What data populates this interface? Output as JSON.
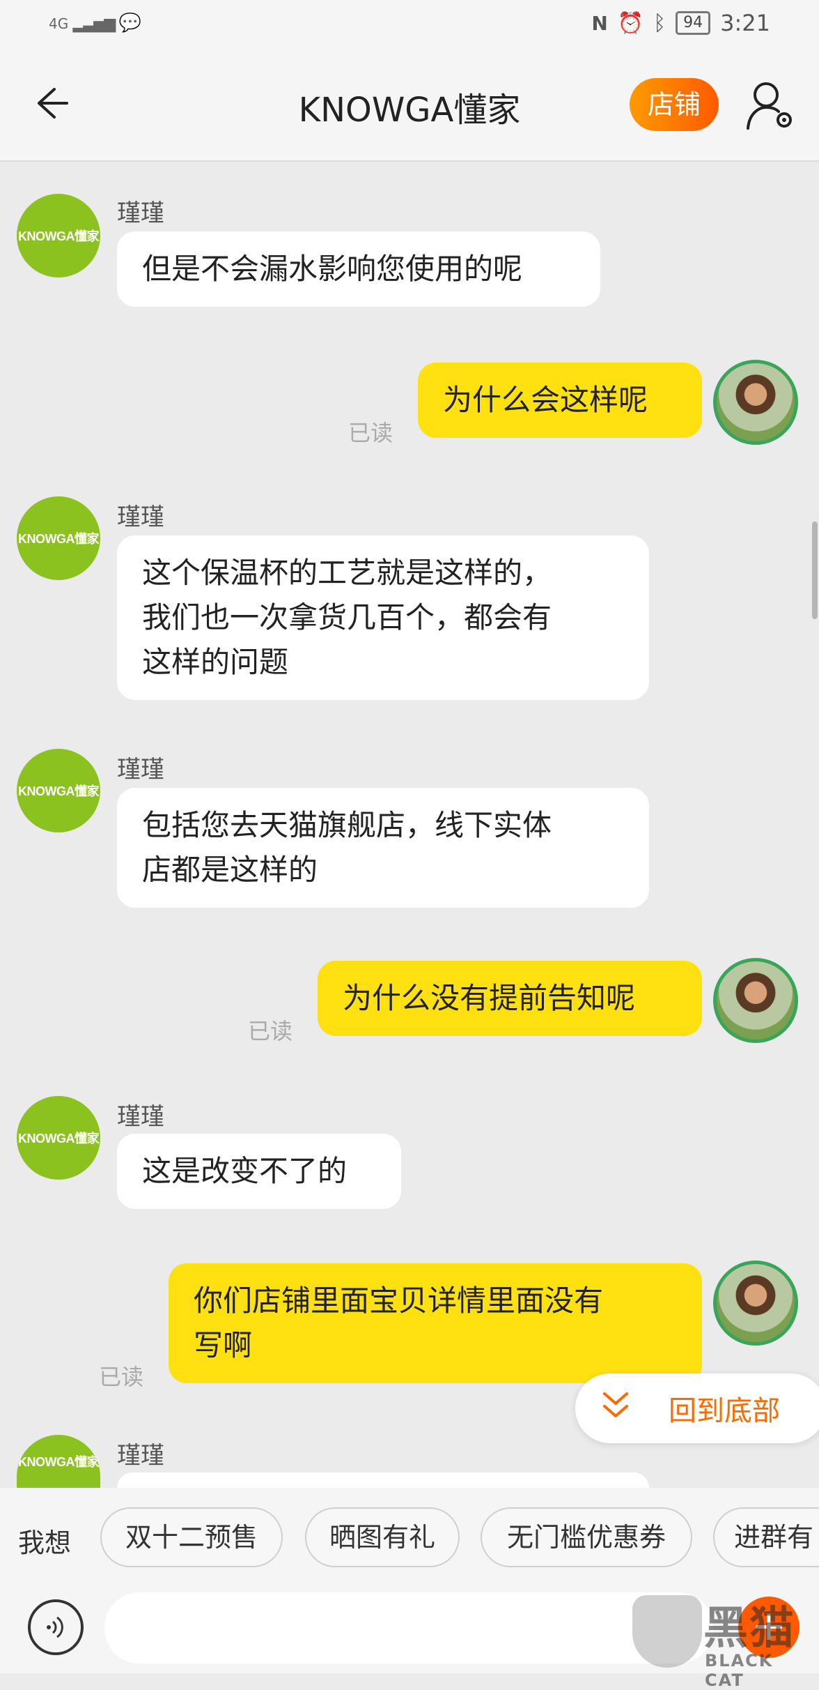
{
  "status_bar": {
    "network": "4G",
    "battery": "94",
    "time": "3:21"
  },
  "header": {
    "title": "KNOWGA懂家",
    "shop_button": "店铺",
    "back_icon": "arrow-left-icon",
    "settings_icon": "user-settings-icon"
  },
  "shop_avatar_text": "KNOWGA懂家",
  "messages": [
    {
      "from": "shop",
      "sender": "瑾瑾",
      "text": "但是不会漏水影响您使用的呢"
    },
    {
      "from": "user",
      "text": "为什么会这样呢",
      "read": "已读"
    },
    {
      "from": "shop",
      "sender": "瑾瑾",
      "lines": [
        "这个保温杯的工艺就是这样的，",
        "我们也一次拿货几百个，都会有",
        "这样的问题"
      ]
    },
    {
      "from": "shop",
      "sender": "瑾瑾",
      "lines": [
        "包括您去天猫旗舰店，线下实体",
        "店都是这样的"
      ]
    },
    {
      "from": "user",
      "text": "为什么没有提前告知呢",
      "read": "已读"
    },
    {
      "from": "shop",
      "sender": "瑾瑾",
      "text": "这是改变不了的"
    },
    {
      "from": "user",
      "lines": [
        "你们店铺里面宝贝详情里面没有",
        "写啊"
      ],
      "read": "已读"
    },
    {
      "from": "shop",
      "sender": "瑾瑾"
    }
  ],
  "scroll_to_bottom": "回到底部",
  "quick_bar": {
    "prefix": "我想",
    "chips": [
      "双十二预售",
      "晒图有礼",
      "无门槛优惠券",
      "进群有"
    ]
  },
  "watermark": {
    "cn": "黑猫",
    "en": "BLACK CAT"
  },
  "colors": {
    "accent_orange": "#ff5a00",
    "out_bubble": "#ffe112",
    "shop_avatar": "#8cc21f"
  }
}
